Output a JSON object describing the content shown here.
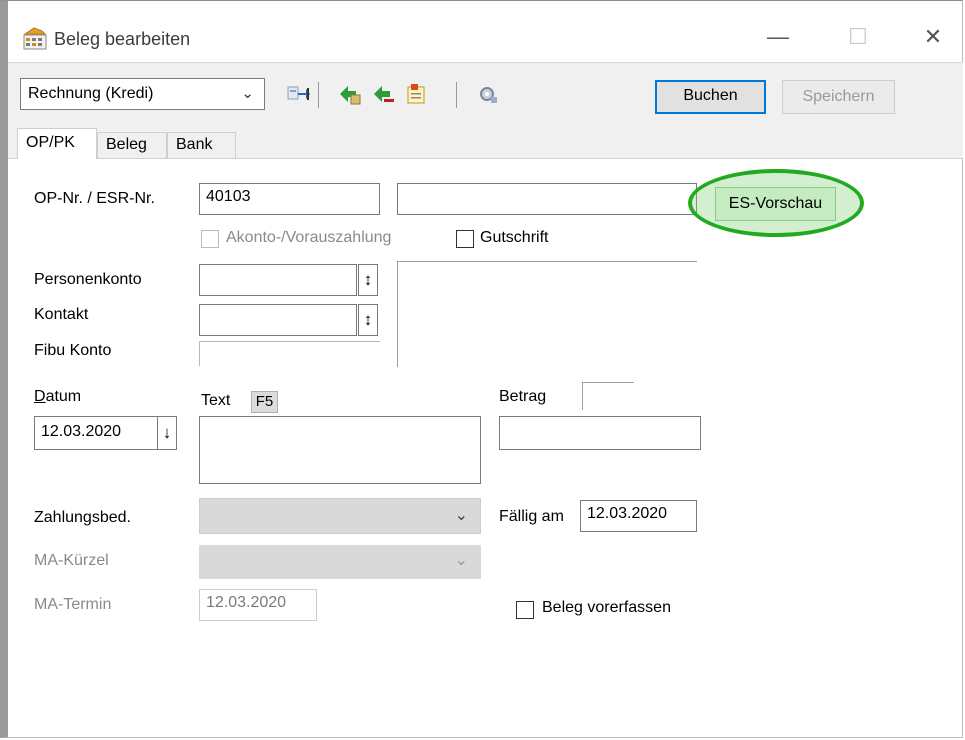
{
  "window": {
    "title": "Beleg bearbeiten",
    "minimize_glyph": "—",
    "maximize_glyph": "☐",
    "close_glyph": "✕"
  },
  "toolbar": {
    "doc_type_value": "Rechnung (Kredi)",
    "book_label": "Buchen",
    "save_label": "Speichern",
    "icons": [
      "transfer-icon",
      "add-entry-icon",
      "remove-entry-icon",
      "note-icon",
      "settings-icon"
    ]
  },
  "tabs": [
    {
      "label": "OP/PK",
      "active": true
    },
    {
      "label": "Beleg",
      "active": false
    },
    {
      "label": "Bank",
      "active": false
    }
  ],
  "form": {
    "op_label": "OP-Nr. / ESR-Nr.",
    "op_value": "40103",
    "esr_value": "",
    "es_preview_label": "ES-Vorschau",
    "akonto_label": "Akonto-/Vorauszahlung",
    "gutschrift_label": "Gutschrift",
    "personenkonto_label": "Personenkonto",
    "kontakt_label": "Kontakt",
    "fibu_label": "Fibu Konto",
    "datum_label": "Datum",
    "datum_value": "12.03.2020",
    "text_label": "Text",
    "f5_label": "F5",
    "betrag_label": "Betrag",
    "zahlungsbed_label": "Zahlungsbed.",
    "faellig_label": "Fällig am",
    "faellig_value": "12.03.2020",
    "ma_kuerzel_label": "MA-Kürzel",
    "ma_termin_label": "MA-Termin",
    "ma_termin_value": "12.03.2020",
    "beleg_vorerfassen_label": "Beleg vorerfassen",
    "spin_glyph": "↕",
    "down_glyph": "↓",
    "chevron_glyph": "⌄"
  },
  "colors": {
    "highlight_green": "#1faa22",
    "primary_button_border": "#0078d7"
  }
}
